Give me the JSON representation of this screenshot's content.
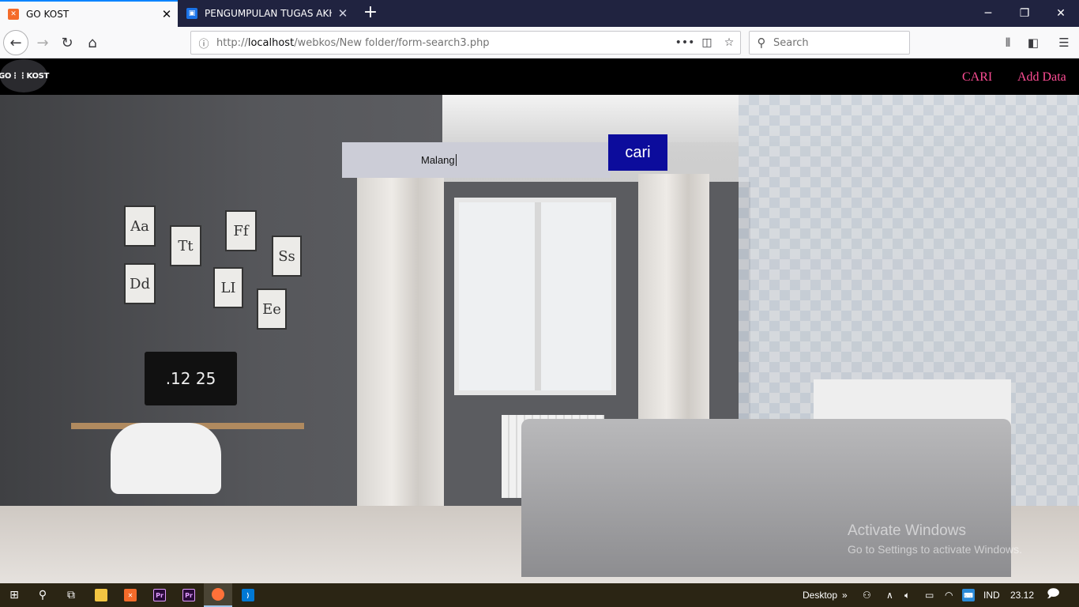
{
  "browser": {
    "tabs": [
      {
        "title": "GO KOST",
        "active": true,
        "favicon": "xampp-icon"
      },
      {
        "title": "PENGUMPULAN TUGAS AKHIR",
        "active": false,
        "favicon": "classroom-icon"
      }
    ],
    "url_prefix": "http://",
    "url_host": "localhost",
    "url_path": "/webkos/New folder/form-search3.php",
    "search_placeholder": "Search"
  },
  "site": {
    "logo_text": "GO⋮⋮KOST",
    "nav": [
      {
        "label": "CARI"
      },
      {
        "label": "Add Data"
      }
    ],
    "search_value": "Malang",
    "search_button": "cari",
    "nav_link_color": "#ff4d95",
    "button_color": "#0c0c9c"
  },
  "room_art": {
    "monitor_time": ".12 25",
    "frames": [
      "Aa",
      "Tt",
      "Ff",
      "Ss",
      "Dd",
      "LI",
      "Ee"
    ]
  },
  "watermark": {
    "line1": "Activate Windows",
    "line2": "Go to Settings to activate Windows."
  },
  "taskbar": {
    "desktop_label": "Desktop",
    "lang": "IND",
    "time": "23.12"
  }
}
